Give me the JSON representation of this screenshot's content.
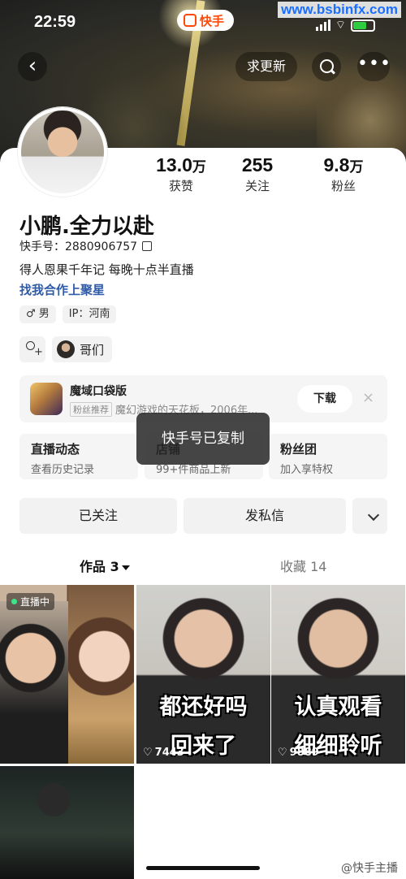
{
  "status": {
    "time": "22:59",
    "app_brand": "快手",
    "watermark": "www.bsbinfx.com"
  },
  "nav": {
    "back_icon": "chevron-left-icon",
    "update_label": "求更新",
    "search_icon": "search-icon",
    "more_icon": "more-dots-icon"
  },
  "stats": [
    {
      "num": "13.0",
      "unit": "万",
      "label": "获赞"
    },
    {
      "num": "255",
      "unit": "",
      "label": "关注"
    },
    {
      "num": "9.8",
      "unit": "万",
      "label": "粉丝"
    }
  ],
  "profile": {
    "name": "小鹏.全力以赴",
    "uid_text": "快手号：2880906757",
    "bio": "得人恩果千年记 每晚十点半直播",
    "biz_link": "找我合作上聚星",
    "tags": [
      "♂ 男",
      "IP：河南"
    ],
    "friend_label": "哥们"
  },
  "game": {
    "title": "魔域口袋版",
    "badge": "粉丝推荐",
    "desc": "魔幻游戏的天花板，2006年...",
    "download": "下载",
    "close": "×"
  },
  "shortcuts": [
    {
      "title": "直播动态",
      "sub": "查看历史记录"
    },
    {
      "title": "店铺",
      "sub": "99+件商品上新"
    },
    {
      "title": "粉丝团",
      "sub": "加入享特权"
    }
  ],
  "toast": "快手号已复制",
  "actions": {
    "followed": "已关注",
    "message": "发私信"
  },
  "tabs": {
    "works": "作品 3",
    "collects": "收藏 14"
  },
  "videos": [
    {
      "live": "直播中",
      "caption": "",
      "likes": ""
    },
    {
      "live": "",
      "caption_line1": "都还好吗",
      "caption_line2": "回来了",
      "likes": "7443"
    },
    {
      "live": "",
      "caption_line1": "认真观看",
      "caption_line2": "细细聆听",
      "likes": "9889"
    },
    {
      "live": "",
      "caption": "",
      "likes": ""
    }
  ],
  "footer_watermark": "@快手主播"
}
